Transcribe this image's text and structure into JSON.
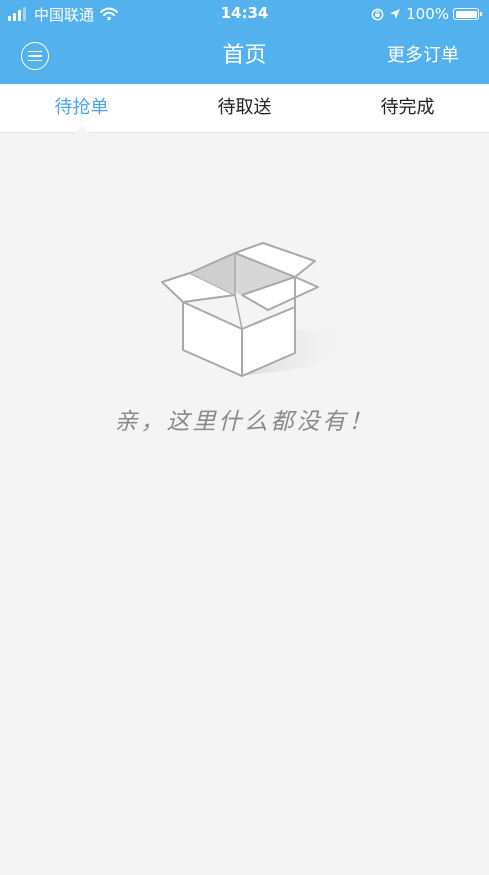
{
  "status_bar": {
    "carrier": "中国联通",
    "time": "14:34",
    "battery": "100%",
    "battery_level": 1.0
  },
  "header": {
    "title": "首页",
    "more_orders": "更多订单"
  },
  "tabs": [
    {
      "label": "待抢单",
      "active": true
    },
    {
      "label": "待取送",
      "active": false
    },
    {
      "label": "待完成",
      "active": false
    }
  ],
  "empty_state": {
    "message": "亲，这里什么都没有！"
  },
  "colors": {
    "header_bg": "#53b1ee",
    "active_tab": "#4aa6e8",
    "page_bg": "#f4f4f4"
  }
}
